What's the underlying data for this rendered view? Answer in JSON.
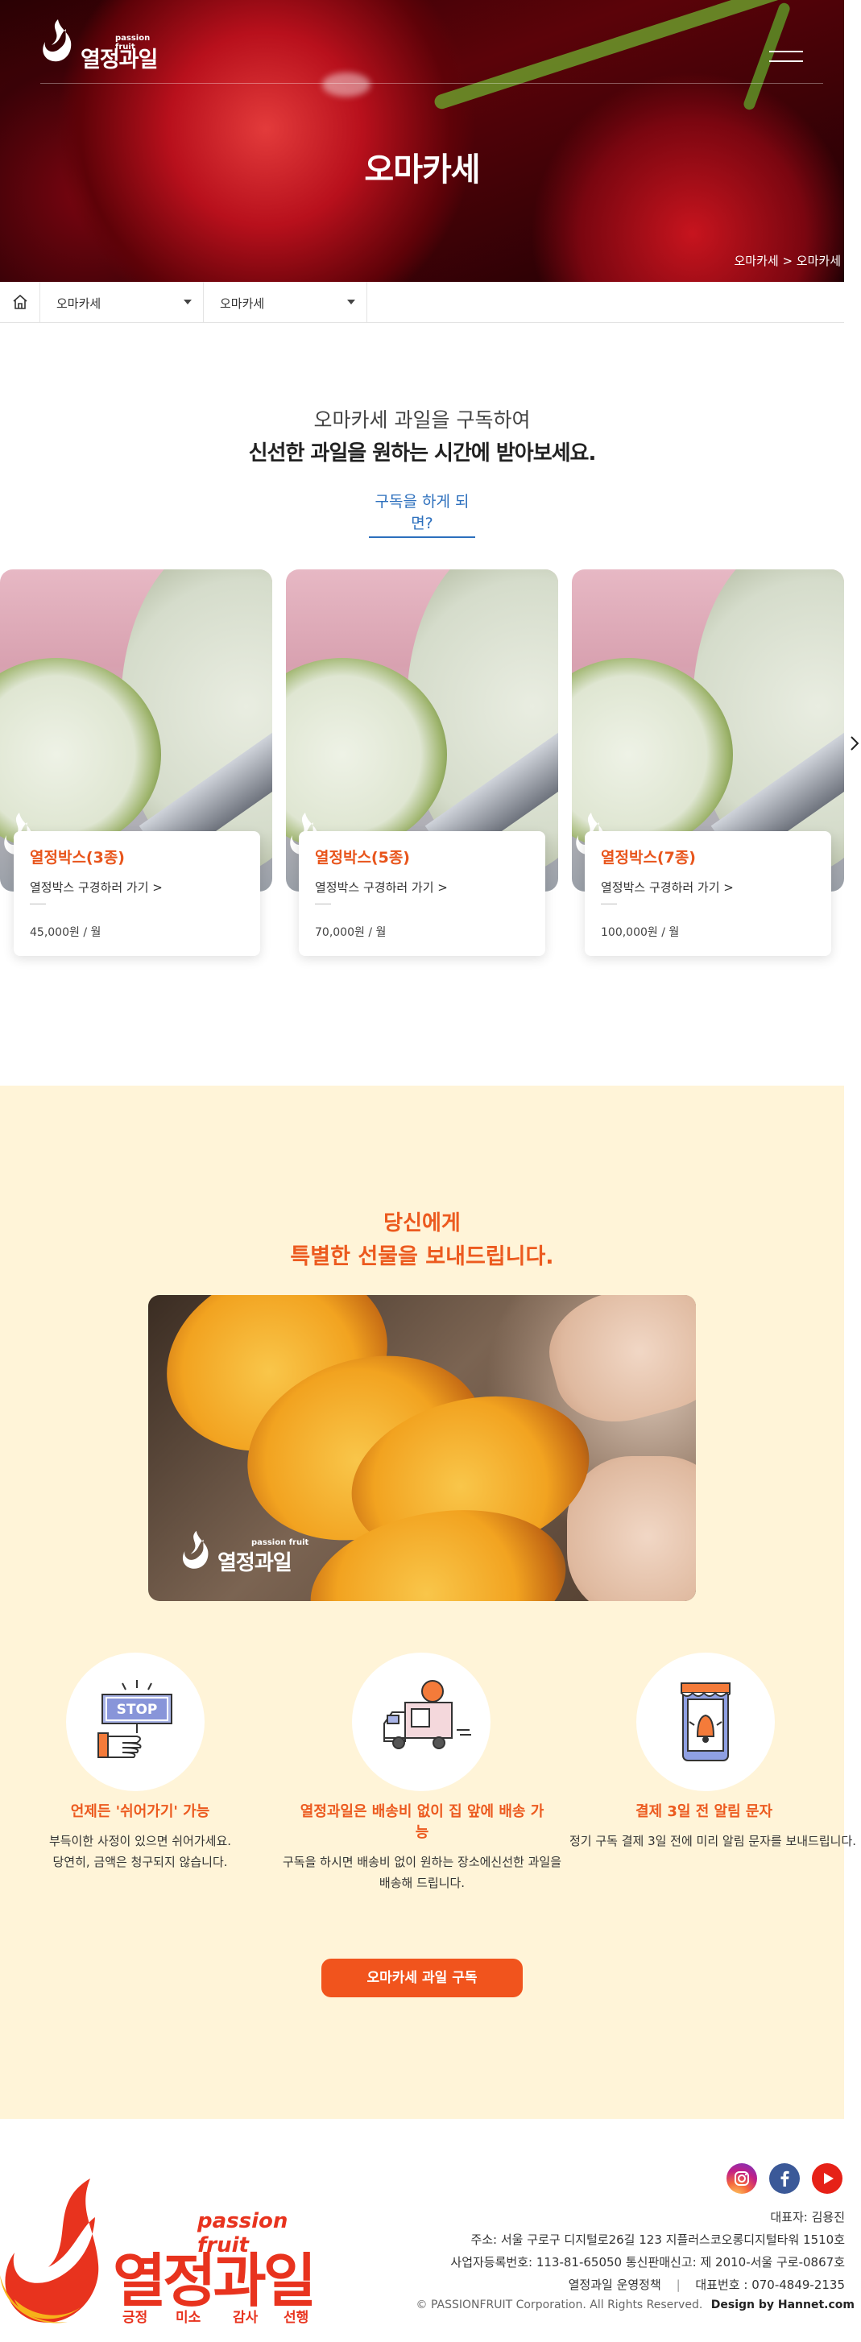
{
  "header": {
    "logo_sub": "passion fruit",
    "logo_name": "열정과일",
    "page_title": "오마카세",
    "breadcrumb": "오마카세 > 오마카세"
  },
  "subnav": {
    "dropdown1": "오마카세",
    "dropdown2": "오마카세"
  },
  "intro": {
    "line1": "오마카세 과일을 구독하여",
    "line2": "신선한 과일을 원하는 시간에 받아보세요.",
    "link": "구독을 하게 되면?"
  },
  "cards": [
    {
      "name": "열정박스(3종)",
      "link": "열정박스 구경하러 가기 >",
      "price": "45,000원 / 월"
    },
    {
      "name": "열정박스(5종)",
      "link": "열정박스 구경하러 가기 >",
      "price": "70,000원 / 월"
    },
    {
      "name": "열정박스(7종)",
      "link": "열정박스 구경하러 가기 >",
      "price": "100,000원 / 월"
    }
  ],
  "gift": {
    "title1": "당신에게",
    "title2": "특별한 선물을 보내드립니다.",
    "img_logo_sub": "passion fruit",
    "img_logo_name": "열정과일",
    "features": [
      {
        "icon": "stop-sign-icon",
        "title": "언제든 '쉬어가기' 가능",
        "desc1": "부득이한 사정이 있으면 쉬어가세요.",
        "desc2": "당연히, 금액은 청구되지 않습니다."
      },
      {
        "icon": "delivery-truck-icon",
        "title1": "열정과일은 배송비 없이 집 앞에 배송 가",
        "title2": "능",
        "desc1": "구독을 하시면 배송비 없이 원하는 장소에신선한 과일을",
        "desc2": "배송해 드립니다."
      },
      {
        "icon": "phone-notification-icon",
        "title": "결제 3일 전 알림 문자",
        "desc1": "정기 구독 결제 3일 전에 미리 알림 문자를 보내드립니다."
      }
    ],
    "cta": "오마카세 과일 구독"
  },
  "footer": {
    "logo_sub": "passion fruit",
    "logo_name": "열정과일",
    "tags": [
      "긍정",
      "미소",
      "감사",
      "선행"
    ],
    "ceo": "대표자: 김용진",
    "address": "주소: 서울 구로구 디지털로26길 123 지플러스코오롱디지털타워 1510호",
    "biz": "사업자등록번호: 113-81-65050      통신판매신고: 제 2010-서울 구로-0867호",
    "policy": "열정과일 운영정책",
    "phone": "대표번호 : 070-4849-2135",
    "copyright": "© PASSIONFRUIT Corporation. All Rights Reserved.",
    "design": "Design by Hannet.com"
  },
  "colors": {
    "accent": "#ec5a1f",
    "gift_bg": "#fff4d8",
    "link": "#2c6fbd"
  }
}
